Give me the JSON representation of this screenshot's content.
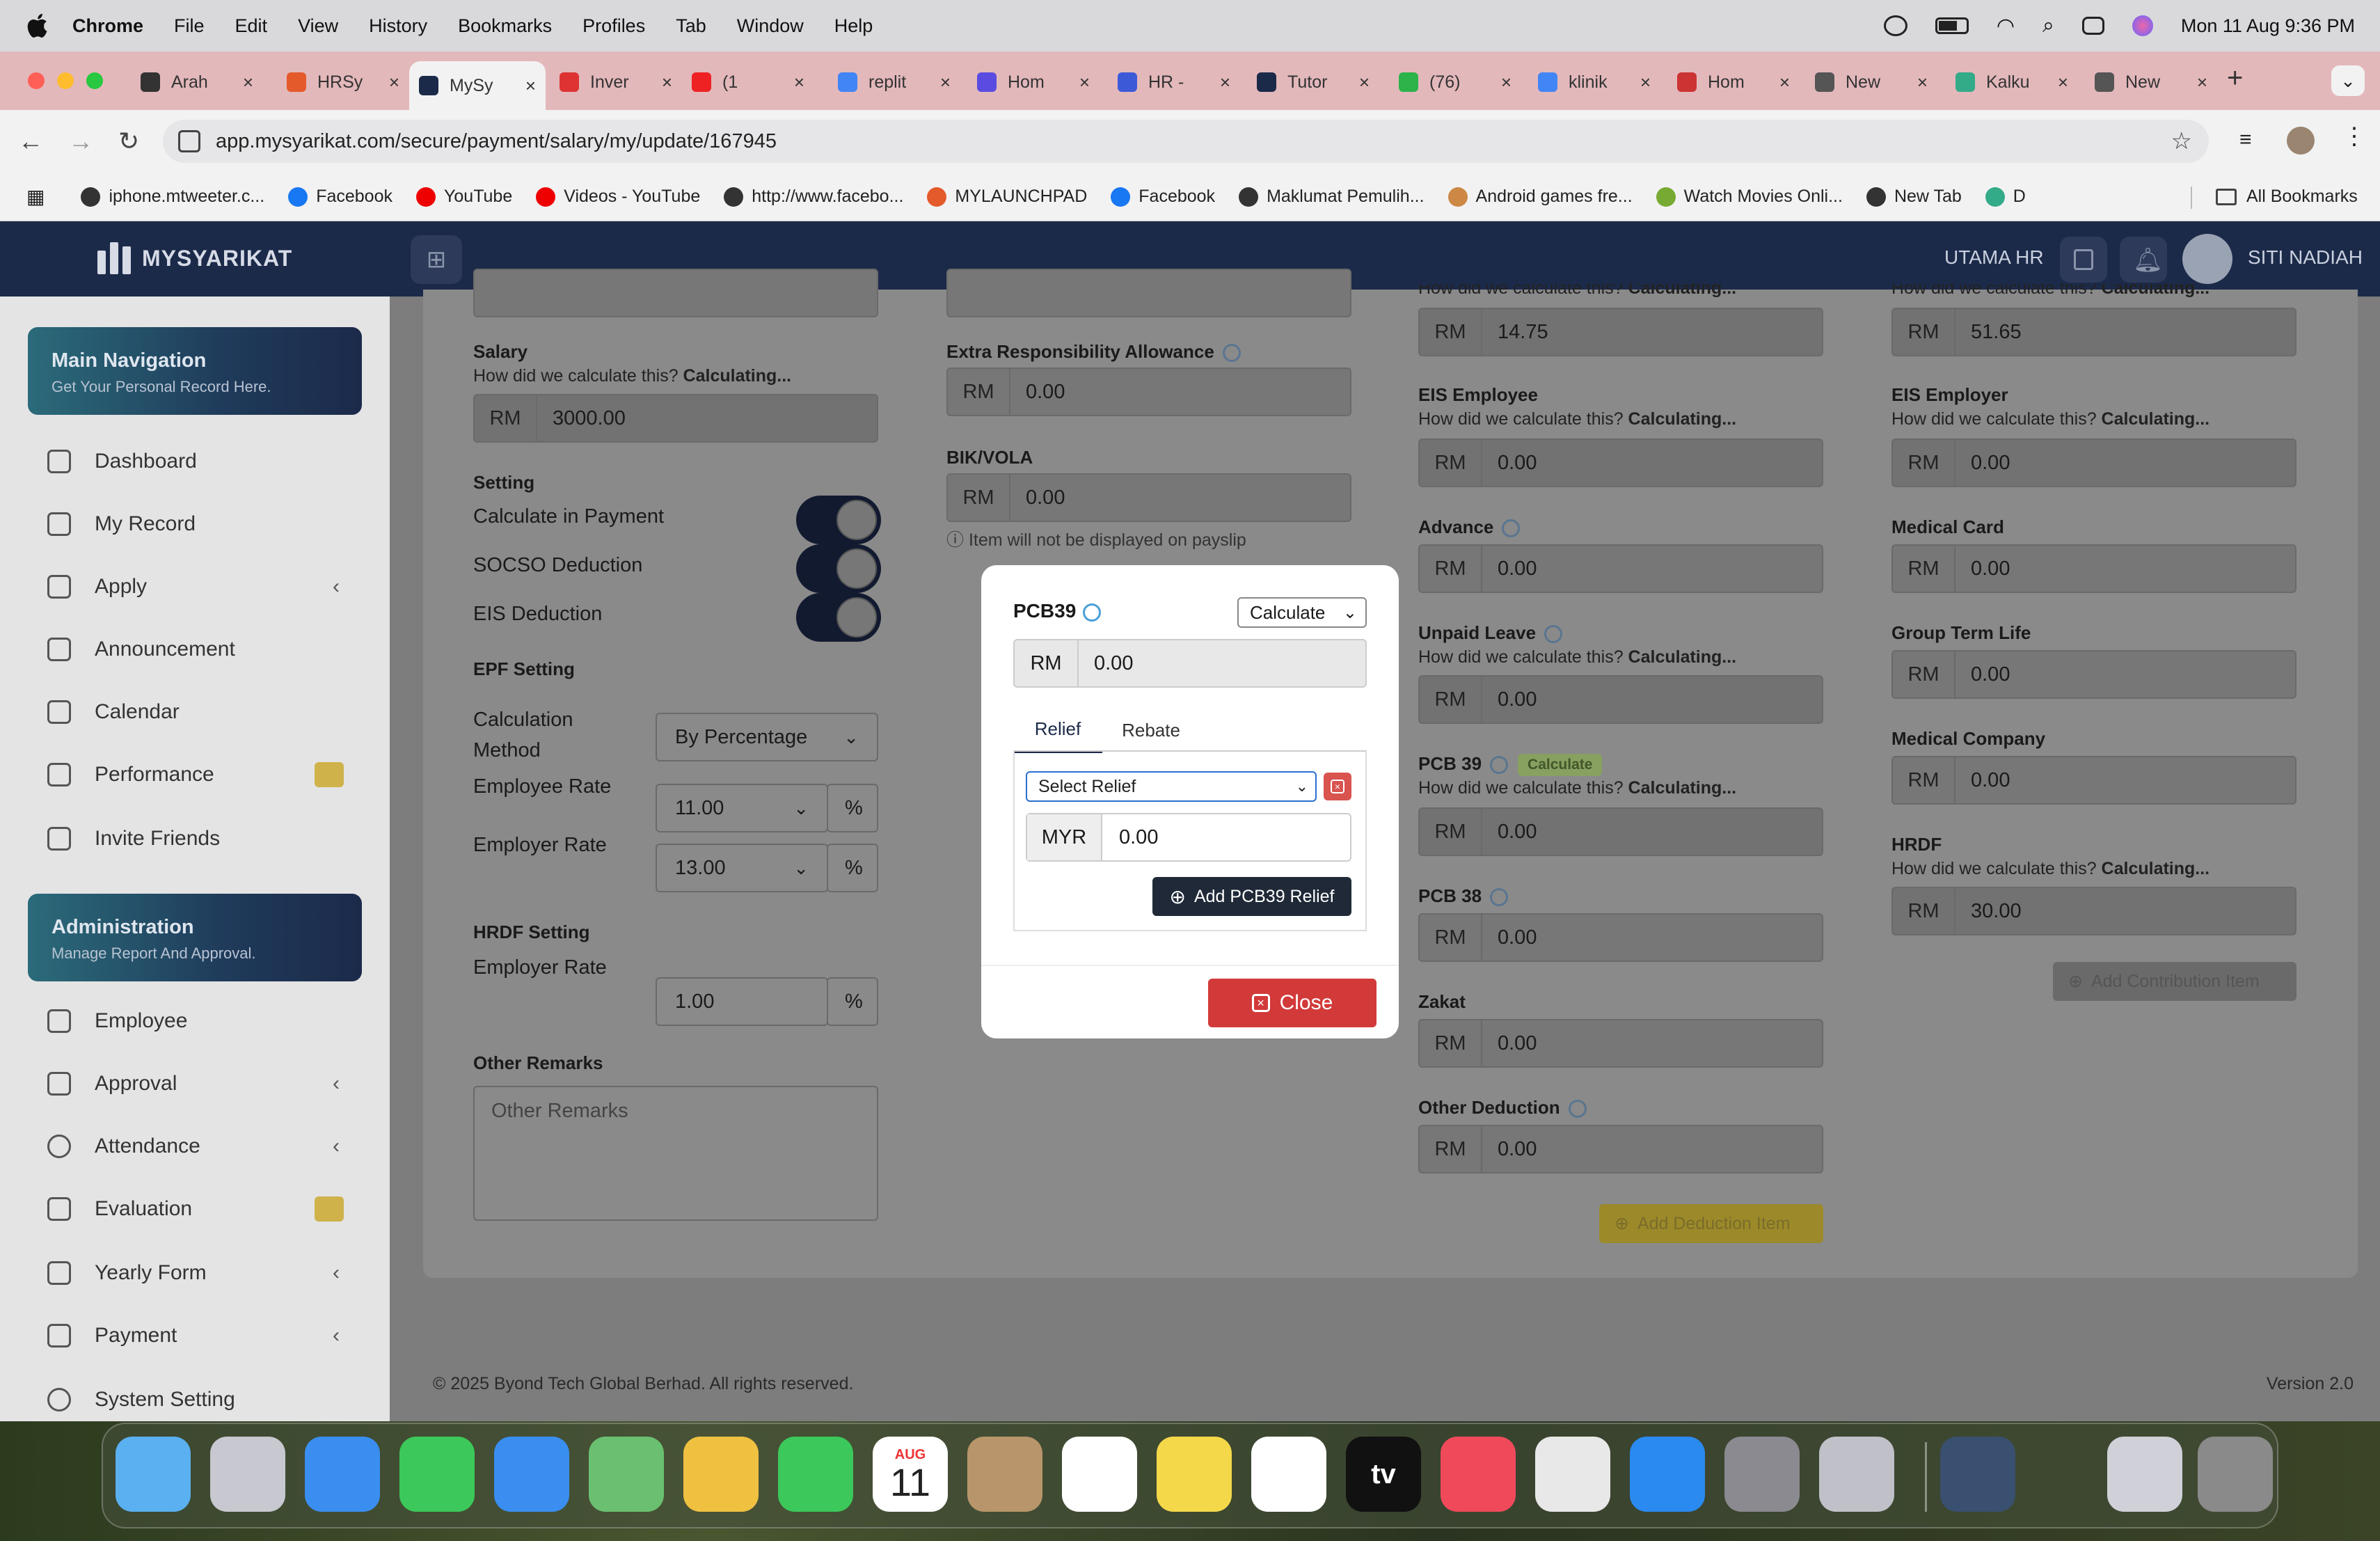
{
  "menubar": {
    "app": "Chrome",
    "items": [
      "File",
      "Edit",
      "View",
      "History",
      "Bookmarks",
      "Profiles",
      "Tab",
      "Window",
      "Help"
    ],
    "clock": "Mon 11 Aug  9:36 PM"
  },
  "tabs": [
    {
      "label": "Arah",
      "color": "#333"
    },
    {
      "label": "HRSy",
      "color": "#e45a2b"
    },
    {
      "label": "MySy",
      "color": "#1c2a4a"
    },
    {
      "label": "Inver",
      "color": "#d33"
    },
    {
      "label": "(1",
      "color": "#e22"
    },
    {
      "label": "replit",
      "color": "#4285f4"
    },
    {
      "label": "Hom",
      "color": "#5a4ce0"
    },
    {
      "label": "HR -",
      "color": "#3c5ad8"
    },
    {
      "label": "Tutor",
      "color": "#1c2a4a"
    },
    {
      "label": "(76)",
      "color": "#2cb34a"
    },
    {
      "label": "klinik",
      "color": "#4285f4"
    },
    {
      "label": "Hom",
      "color": "#c33"
    },
    {
      "label": "New",
      "color": "#555"
    },
    {
      "label": "Kalku",
      "color": "#3a8"
    },
    {
      "label": "New",
      "color": "#555"
    }
  ],
  "url": "app.mysyarikat.com/secure/payment/salary/my/update/167945",
  "bookmarks": [
    {
      "label": "iphone.mtweeter.c...",
      "color": "#333"
    },
    {
      "label": "Facebook",
      "color": "#1877f2"
    },
    {
      "label": "YouTube",
      "color": "#e00"
    },
    {
      "label": "Videos - YouTube",
      "color": "#e00"
    },
    {
      "label": "http://www.facebo...",
      "color": "#333"
    },
    {
      "label": "MYLAUNCHPAD",
      "color": "#e45a2b"
    },
    {
      "label": "Facebook",
      "color": "#1877f2"
    },
    {
      "label": "Maklumat Pemulih...",
      "color": "#333"
    },
    {
      "label": "Android games fre...",
      "color": "#c84"
    },
    {
      "label": "Watch Movies Onli...",
      "color": "#7a3"
    },
    {
      "label": "New Tab",
      "color": "#333"
    },
    {
      "label": "D",
      "color": "#3a8"
    }
  ],
  "all_bookmarks": "All Bookmarks",
  "header": {
    "brand": "MYSYARIKAT",
    "company": "UTAMA HR",
    "user": "SITI NADIAH"
  },
  "sidebar": {
    "main_title": "Main Navigation",
    "main_sub": "Get Your Personal Record Here.",
    "admin_title": "Administration",
    "admin_sub": "Manage Report And Approval.",
    "main_items": [
      "Dashboard",
      "My Record",
      "Apply",
      "Announcement",
      "Calendar",
      "Performance",
      "Invite Friends"
    ],
    "admin_items": [
      "Employee",
      "Approval",
      "Attendance",
      "Evaluation",
      "Yearly Form",
      "Payment",
      "System Setting"
    ]
  },
  "form": {
    "how": "How did we calculate this?",
    "calc": "Calculating...",
    "rm": "RM",
    "pct": "%",
    "salary_label": "Salary",
    "salary": "3000.00",
    "setting": "Setting",
    "calc_payment": "Calculate in Payment",
    "socso": "SOCSO Deduction",
    "eis": "EIS Deduction",
    "epf_setting": "EPF Setting",
    "calc_method": "Calculation",
    "calc_method2": "Method",
    "calc_method_val": "By Percentage",
    "emp_rate": "Employee Rate",
    "emp_rate_val": "11.00",
    "er_rate": "Employer Rate",
    "er_rate_val": "13.00",
    "hrdf_setting": "HRDF Setting",
    "hrdf_rate": "Employer Rate",
    "hrdf_rate_val": "1.00",
    "remarks_label": "Other Remarks",
    "remarks_ph": "Other Remarks",
    "extra_label": "Extra Responsibility Allowance",
    "extra_val": "0.00",
    "bik_label": "BIK/VOLA",
    "bik_val": "0.00",
    "bik_note": "Item will not be displayed on payslip",
    "col3_top": "14.75",
    "eis_emp": "EIS Employee",
    "eis_emp_val": "0.00",
    "advance": "Advance",
    "advance_val": "0.00",
    "unpaid": "Unpaid Leave",
    "unpaid_val": "0.00",
    "pcb39": "PCB 39",
    "pcb39_pill": "Calculate",
    "pcb39_val": "0.00",
    "pcb38": "PCB 38",
    "pcb38_val": "0.00",
    "zakat": "Zakat",
    "zakat_val": "0.00",
    "other_ded": "Other Deduction",
    "other_ded_val": "0.00",
    "add_deduction": "Add Deduction Item",
    "col4_top": "51.65",
    "eis_er": "EIS Employer",
    "eis_er_val": "0.00",
    "medical_card": "Medical Card",
    "medical_card_val": "0.00",
    "gtl": "Group Term Life",
    "gtl_val": "0.00",
    "medical_co": "Medical Company",
    "medical_co_val": "0.00",
    "hrdf": "HRDF",
    "hrdf_val": "30.00",
    "add_contribution": "Add Contribution Item"
  },
  "modal": {
    "title": "PCB39",
    "mode": "Calculate",
    "rm": "RM",
    "value": "0.00",
    "tab_relief": "Relief",
    "tab_rebate": "Rebate",
    "select_relief": "Select Relief",
    "myr": "MYR",
    "relief_val": "0.00",
    "add_btn": "Add PCB39 Relief",
    "close": "Close"
  },
  "footer": {
    "copyright": "© 2025 Byond Tech Global Berhad. All rights reserved.",
    "version": "Version 2.0"
  },
  "dock": {
    "cal_month": "AUG",
    "cal_day": "11",
    "tv": "tv"
  }
}
